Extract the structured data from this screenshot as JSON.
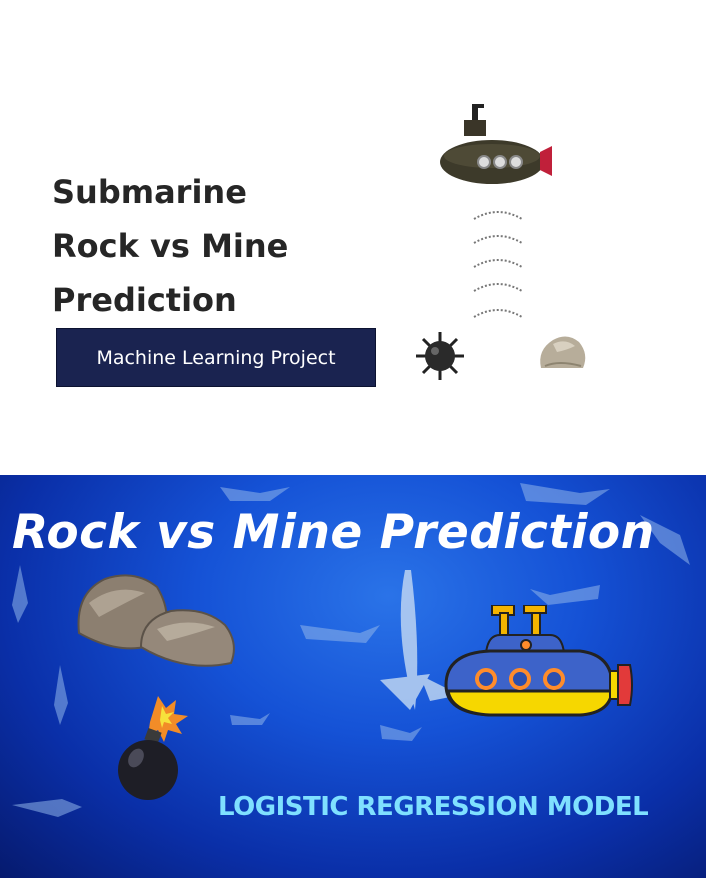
{
  "top_panel": {
    "title_lines": [
      "Submarine",
      "Rock vs Mine",
      "Prediction"
    ],
    "subtitle": "Machine Learning Project"
  },
  "bottom_panel": {
    "title": "Rock vs Mine Prediction",
    "model": "LOGISTIC REGRESSION MODEL"
  },
  "colors": {
    "box_bg": "#1a2350",
    "title_bottom": "#ffffff",
    "model_text": "#7fe0ff",
    "ocean": "#1552d6"
  },
  "icons": [
    "submarine-icon",
    "sonar-waves-icon",
    "sea-mine-icon",
    "rock-icon",
    "bomb-icon",
    "shark-icon",
    "cartoon-submarine-icon",
    "boulders-icon"
  ]
}
